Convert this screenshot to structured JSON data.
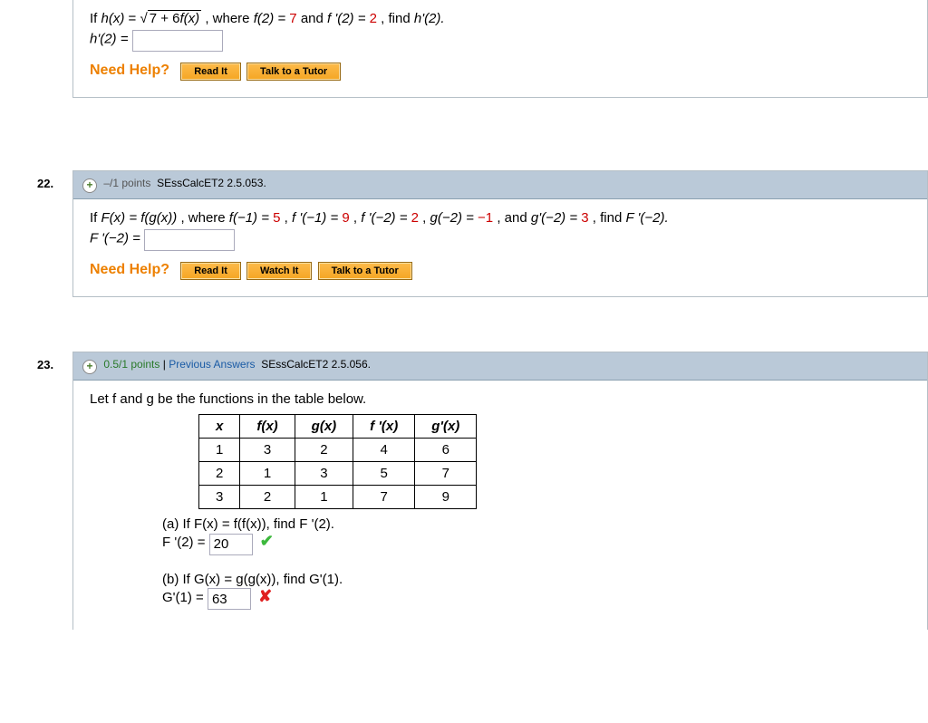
{
  "q21": {
    "stmt_prefix": "If ",
    "hx": "h(x)",
    "eq1": " = ",
    "sqrt_inner_a": "7 + 6",
    "sqrt_inner_b": "f(x)",
    "where": " ,  where  ",
    "f2": "f(2) = ",
    "f2v": "7",
    "and1": " and ",
    "fp2": "f '(2) = ",
    "fp2v": "2",
    "find": ",  find ",
    "target": "h'(2).",
    "ans_label": "h'(2) = ",
    "help": "Need Help?",
    "read": "Read It",
    "talk": "Talk to a Tutor"
  },
  "q22": {
    "num": "22.",
    "points": "–/1 points",
    "ref": "SEssCalcET2 2.5.053.",
    "stmt_prefix": "If  ",
    "Fx": "F(x) = f(g(x))",
    "where": ",  where  ",
    "fneg1": "f(−1) = ",
    "fneg1v": "5",
    "c1": ", ",
    "fpneg1": "f '(−1) = ",
    "fpneg1v": "9",
    "c2": ", ",
    "fpneg2": "f '(−2) = ",
    "fpneg2v": "2",
    "c3": ", ",
    "gneg2": "g(−2) = ",
    "gneg2v": "−1",
    "and": ",  and  ",
    "gpneg2": "g'(−2) = ",
    "gpneg2v": "3",
    "find": ", find ",
    "target": "F '(−2).",
    "ans_label": "F '(−2) = ",
    "help": "Need Help?",
    "read": "Read It",
    "watch": "Watch It",
    "talk": "Talk to a Tutor"
  },
  "q23": {
    "num": "23.",
    "points": "0.5/1 points",
    "sep": "  |  ",
    "prev": "Previous Answers",
    "ref": "SEssCalcET2 2.5.056.",
    "intro": "Let f and g be the functions in the table below.",
    "headers": {
      "x": "x",
      "fx": "f(x)",
      "gx": "g(x)",
      "fpx": "f '(x)",
      "gpx": "g'(x)"
    },
    "rows": [
      {
        "x": "1",
        "fx": "3",
        "gx": "2",
        "fpx": "4",
        "gpx": "6"
      },
      {
        "x": "2",
        "fx": "1",
        "gx": "3",
        "fpx": "5",
        "gpx": "7"
      },
      {
        "x": "3",
        "fx": "2",
        "gx": "1",
        "fpx": "7",
        "gpx": "9"
      }
    ],
    "a": {
      "stmt": "(a) If F(x) = f(f(x)), find F '(2).",
      "ans_label": "F '(2) = ",
      "ans_value": "20"
    },
    "b": {
      "stmt": "(b) If G(x) = g(g(x)), find G'(1).",
      "ans_label": "G'(1) = ",
      "ans_value": "63"
    }
  }
}
